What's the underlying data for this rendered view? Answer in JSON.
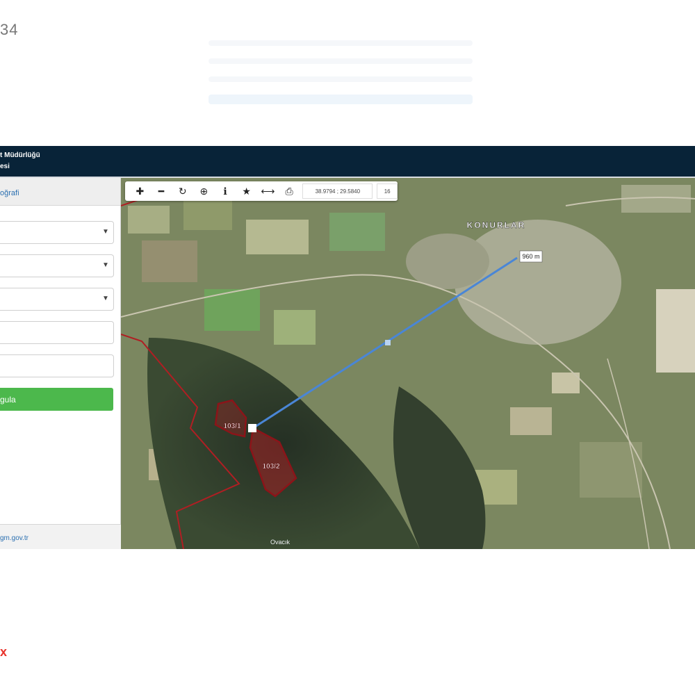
{
  "listing": {
    "id_fragment": "34"
  },
  "header": {
    "line1": "t Müdürlüğü",
    "line2": "esi"
  },
  "sidebar": {
    "tab_label": "oğrafi",
    "fields": [
      {
        "kind": "select",
        "value": ""
      },
      {
        "kind": "select",
        "value": ""
      },
      {
        "kind": "select",
        "value": ""
      },
      {
        "kind": "input",
        "value": ""
      },
      {
        "kind": "input",
        "value": ""
      }
    ],
    "query_button_label": "gula",
    "footer_link": "gm.gov.tr"
  },
  "toolbar": {
    "buttons": [
      {
        "name": "zoom-in-icon",
        "glyph": "✚"
      },
      {
        "name": "zoom-out-icon",
        "glyph": "━"
      },
      {
        "name": "refresh-icon",
        "glyph": "↻"
      },
      {
        "name": "locate-icon",
        "glyph": "⊕"
      },
      {
        "name": "info-icon",
        "glyph": "ℹ"
      },
      {
        "name": "star-icon",
        "glyph": "★"
      },
      {
        "name": "measure-icon",
        "glyph": "⟷"
      },
      {
        "name": "print-icon",
        "glyph": "⎙"
      }
    ],
    "coordinates": "38.9794 ; 29.5840",
    "zoom_level": "16"
  },
  "map": {
    "place_label": "KONURLAR",
    "distance_label": "960 m",
    "parcel_labels": [
      "103/1",
      "103/2"
    ],
    "road_label": "Ovacık",
    "colors": {
      "parcel_outline": "#b01e23",
      "measure_line": "#4a86d6",
      "terrain_dark": "#2f3d2a",
      "terrain_light": "#9aa577"
    }
  },
  "brand": {
    "mark": "x"
  }
}
